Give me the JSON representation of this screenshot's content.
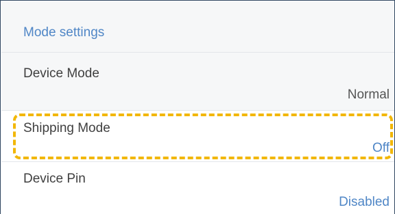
{
  "section": {
    "title": "Mode settings"
  },
  "settings": [
    {
      "label": "Device Mode",
      "value": "Normal"
    },
    {
      "label": "Shipping Mode",
      "value": "Off"
    },
    {
      "label": "Device Pin",
      "value": "Disabled"
    }
  ],
  "colors": {
    "accent": "#4f86c6",
    "highlight": "#f2b705",
    "border": "#2f4560"
  }
}
